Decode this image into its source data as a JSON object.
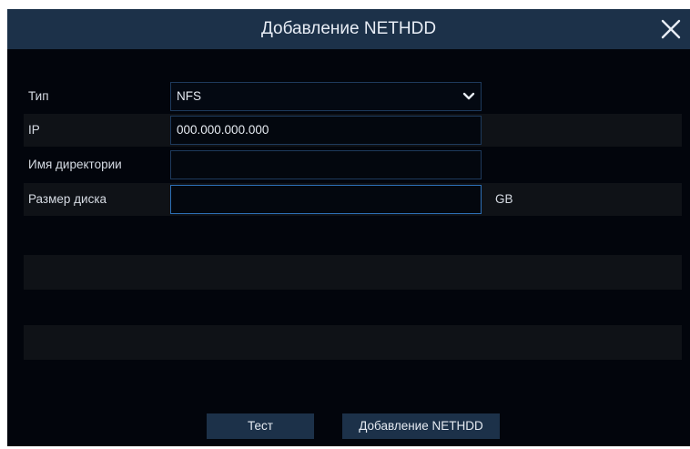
{
  "dialog": {
    "title": "Добавление NETHDD",
    "close_icon": "close-icon"
  },
  "form": {
    "type": {
      "label": "Тип",
      "value": "NFS",
      "icon": "chevron-down-icon"
    },
    "ip": {
      "label": "IP",
      "value": "000.000.000.000"
    },
    "directory": {
      "label": "Имя директории",
      "value": ""
    },
    "disk_size": {
      "label": "Размер диска",
      "value": "",
      "unit": "GB"
    }
  },
  "buttons": {
    "test_label": "Тест",
    "add_label": "Добавление NETHDD"
  },
  "colors": {
    "titlebar": "#1c3149",
    "background": "#02050c",
    "row_shade": "#0f1217",
    "field_border": "#1e3a5c",
    "field_focus_border": "#2d6fb5",
    "button": "#1c3149"
  }
}
